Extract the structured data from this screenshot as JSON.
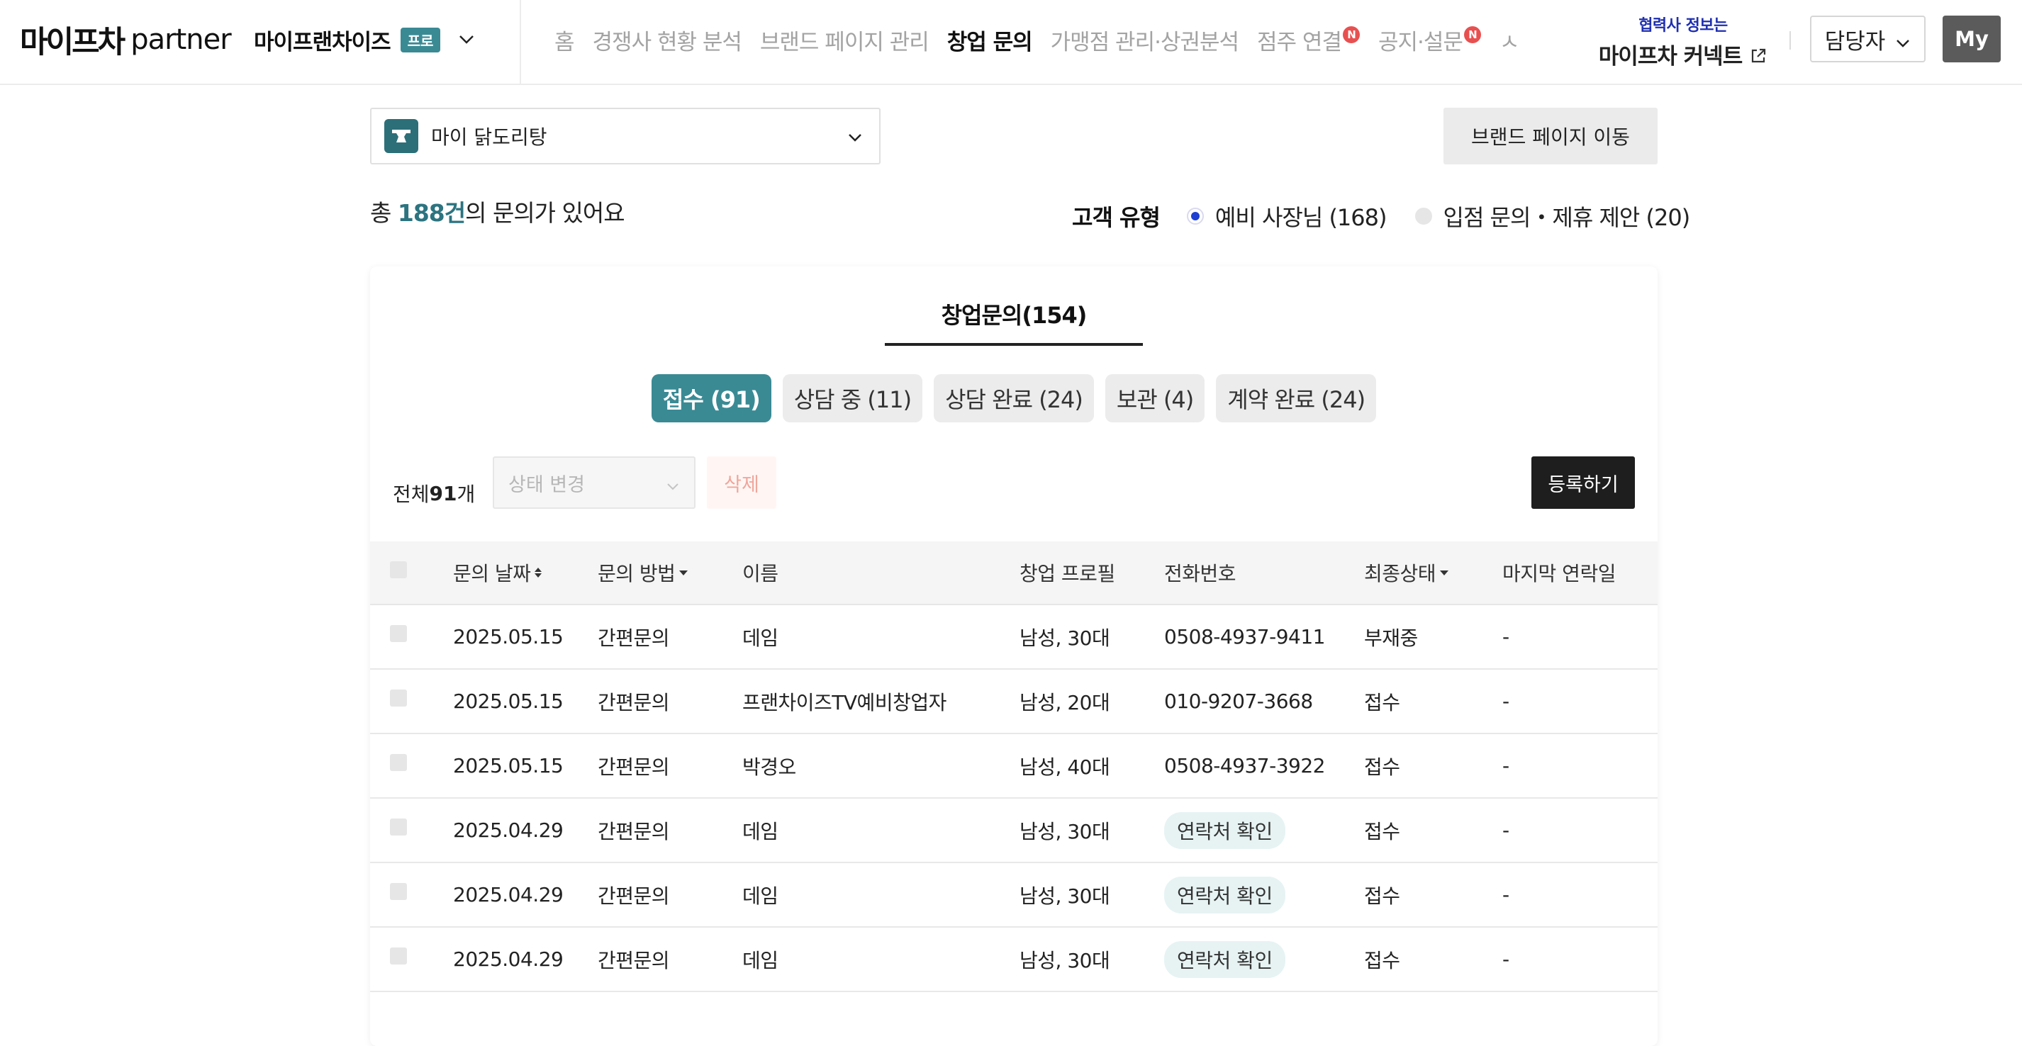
{
  "header": {
    "logo_brand": "마이프차",
    "logo_suffix": "partner",
    "company_name": "마이프랜차이즈",
    "company_badge": "프로",
    "nav": [
      {
        "label": "홈",
        "active": false,
        "badge": ""
      },
      {
        "label": "경쟁사 현황 분석",
        "active": false,
        "badge": ""
      },
      {
        "label": "브랜드 페이지 관리",
        "active": false,
        "badge": ""
      },
      {
        "label": "창업 문의",
        "active": true,
        "badge": ""
      },
      {
        "label": "가맹점 관리·상권분석",
        "active": false,
        "badge": ""
      },
      {
        "label": "점주 연결",
        "active": false,
        "badge": "N"
      },
      {
        "label": "공지·설문",
        "active": false,
        "badge": "N"
      },
      {
        "label": "ㅅ",
        "active": false,
        "badge": ""
      }
    ],
    "connect_sub": "협력사 정보는",
    "connect_main": "마이프차 커넥트",
    "manager_label": "담당자",
    "my_label": "My"
  },
  "brand_bar": {
    "brand_name": "마이 닭도리탕",
    "brand_page_button": "브랜드 페이지 이동"
  },
  "summary": {
    "prefix": "총 ",
    "count": "188건",
    "suffix": "의 문의가 있어요",
    "customer_type_label": "고객 유형",
    "customer_types": [
      {
        "label": "예비 사장님 (168)",
        "selected": true
      },
      {
        "label": "입점 문의・제휴 제안 (20)",
        "selected": false
      }
    ]
  },
  "card": {
    "tab_label": "창업문의(154)",
    "status_tabs": [
      {
        "label": "접수 (91)",
        "active": true
      },
      {
        "label": "상담 중 (11)",
        "active": false
      },
      {
        "label": "상담 완료 (24)",
        "active": false
      },
      {
        "label": "보관 (4)",
        "active": false
      },
      {
        "label": "계약 완료 (24)",
        "active": false
      }
    ],
    "count_prefix": "전체 ",
    "count_value": "91",
    "count_suffix": "개",
    "status_change_placeholder": "상태 변경",
    "delete_label": "삭제",
    "register_label": "등록하기"
  },
  "table": {
    "columns": {
      "date": "문의 날짜",
      "method": "문의 방법",
      "name": "이름",
      "profile": "창업 프로필",
      "phone": "전화번호",
      "status": "최종상태",
      "last": "마지막 연락일"
    },
    "rows": [
      {
        "date": "2025.05.15",
        "method": "간편문의",
        "name": "데임",
        "profile": "남성, 30대",
        "phone": "0508-4937-9411",
        "status": "부재중",
        "last": "-"
      },
      {
        "date": "2025.05.15",
        "method": "간편문의",
        "name": "프랜차이즈TV예비창업자",
        "profile": "남성, 20대",
        "phone": "010-9207-3668",
        "status": "접수",
        "last": "-"
      },
      {
        "date": "2025.05.15",
        "method": "간편문의",
        "name": "박경오",
        "profile": "남성, 40대",
        "phone": "0508-4937-3922",
        "status": "접수",
        "last": "-"
      },
      {
        "date": "2025.04.29",
        "method": "간편문의",
        "name": "데임",
        "profile": "남성, 30대",
        "phone": "연락처 확인",
        "status": "접수",
        "last": "-"
      },
      {
        "date": "2025.04.29",
        "method": "간편문의",
        "name": "데임",
        "profile": "남성, 30대",
        "phone": "연락처 확인",
        "status": "접수",
        "last": "-"
      },
      {
        "date": "2025.04.29",
        "method": "간편문의",
        "name": "데임",
        "profile": "남성, 30대",
        "phone": "연락처 확인",
        "status": "접수",
        "last": "-"
      }
    ]
  },
  "colors": {
    "accent_teal": "#3a8a94",
    "count_teal": "#2c7480",
    "connect_blue": "#1f2fb0",
    "radio_blue": "#1e3fd1",
    "n_badge_red": "#e85050"
  }
}
